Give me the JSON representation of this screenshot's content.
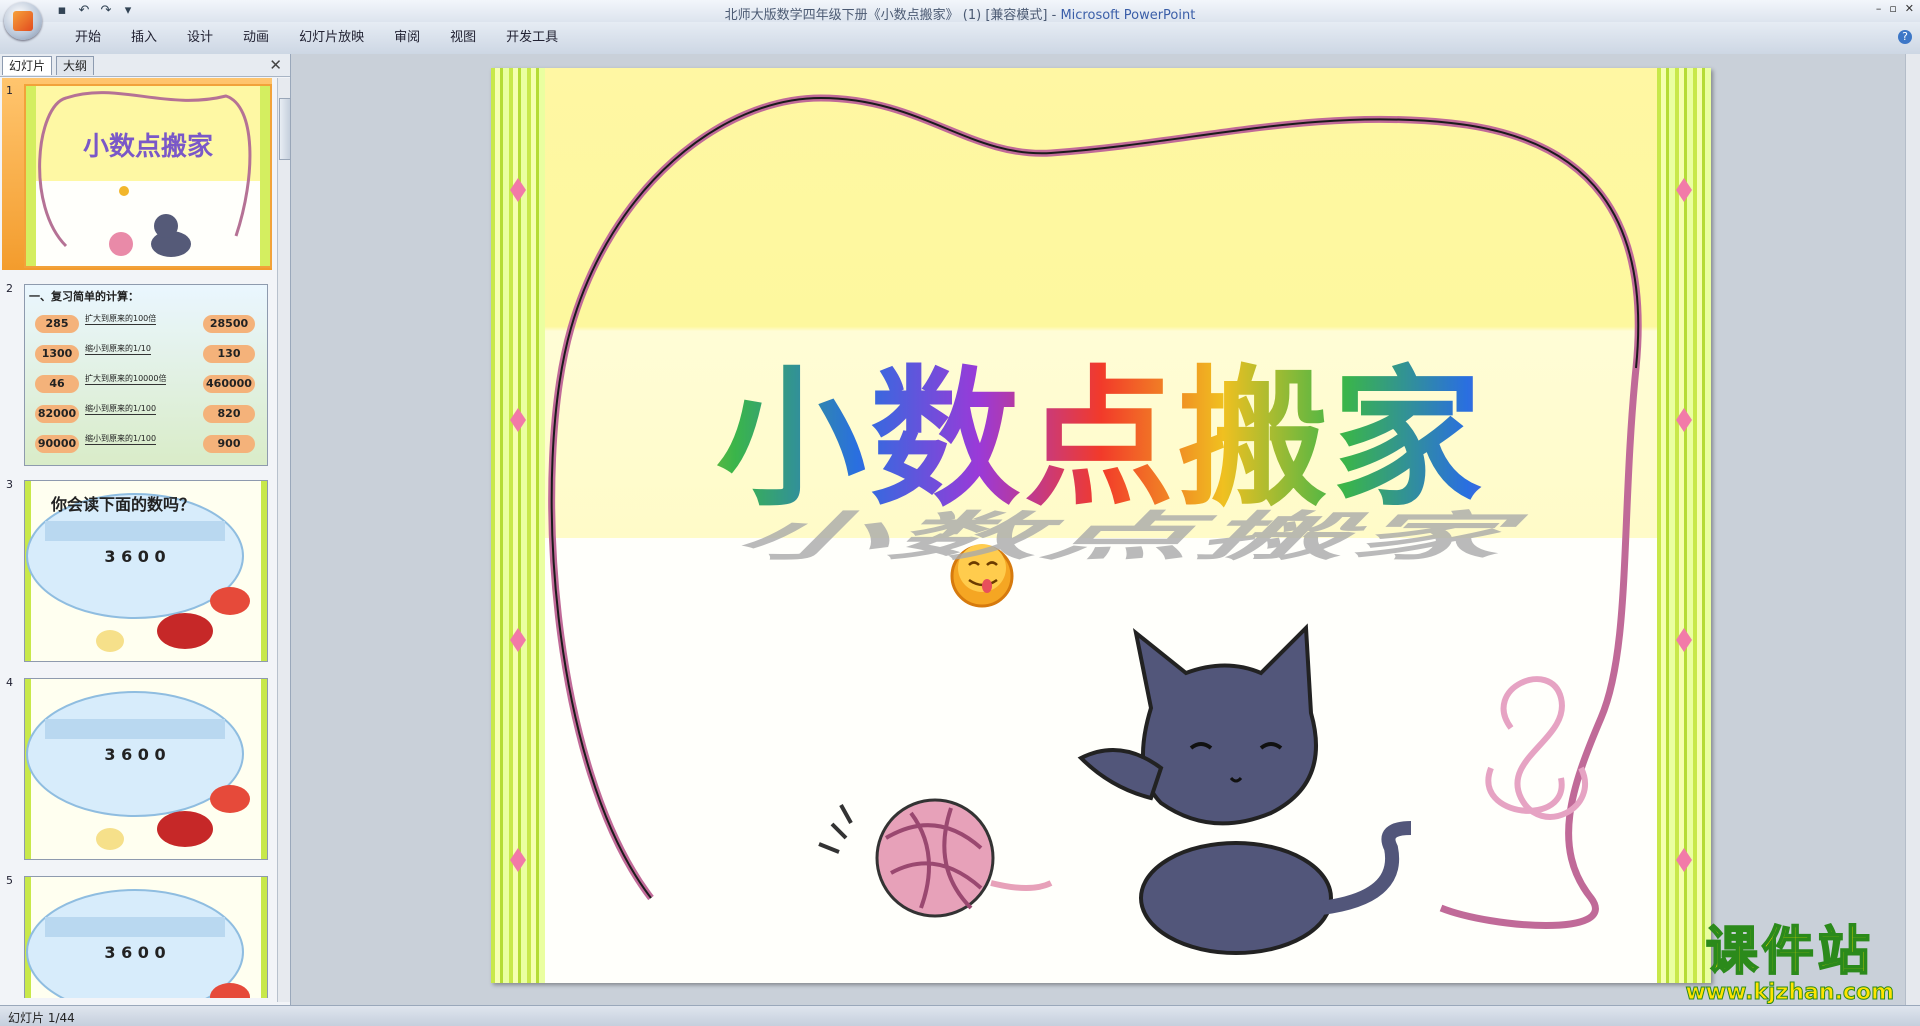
{
  "window": {
    "doc_title": "北师大版数学四年级下册《小数点搬家》 (1) [兼容模式] - ",
    "app_name": "Microsoft PowerPoint"
  },
  "ribbon": {
    "tabs": [
      "开始",
      "插入",
      "设计",
      "动画",
      "幻灯片放映",
      "审阅",
      "视图",
      "开发工具"
    ]
  },
  "panel": {
    "tab_slides": "幻灯片",
    "tab_outline": "大纲",
    "thumbs": [
      {
        "num": "1",
        "title": "小数点搬家"
      },
      {
        "num": "2",
        "heading": "一、复习简单的计算：",
        "rows": [
          {
            "left": "285",
            "op": "扩大到原来的100倍",
            "right": "28500"
          },
          {
            "left": "1300",
            "op": "缩小到原来的1/10",
            "right": "130"
          },
          {
            "left": "46",
            "op": "扩大到原来的10000倍",
            "right": "460000"
          },
          {
            "left": "82000",
            "op": "缩小到原来的1/100",
            "right": "820"
          },
          {
            "left": "90000",
            "op": "缩小到原来的1/100",
            "right": "900"
          }
        ]
      },
      {
        "num": "3",
        "question": "你会读下面的数吗？",
        "number": "3 6 0 0"
      },
      {
        "num": "4",
        "number": "3 6 0 0"
      },
      {
        "num": "5",
        "number": "3 6 0 0"
      }
    ]
  },
  "slide": {
    "title": "小数点搬家"
  },
  "status": {
    "slide_counter": "幻灯片 1/44"
  },
  "watermark": {
    "brand": "课件站",
    "url": "www.kjzhan.com"
  }
}
